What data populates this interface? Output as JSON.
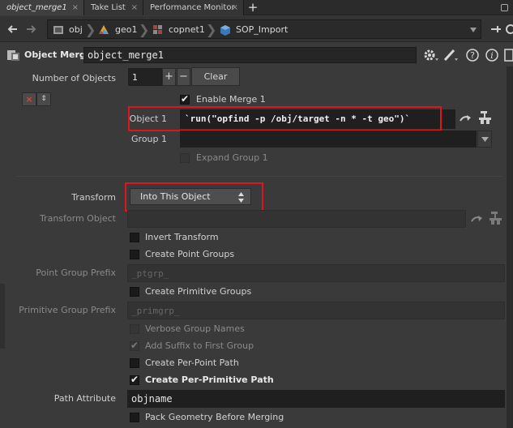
{
  "tabs": [
    {
      "label": "object_merge1",
      "close": "×"
    },
    {
      "label": "Take List",
      "close": "×"
    },
    {
      "label": "Performance Monitor",
      "close": "×"
    }
  ],
  "add_tab": "+",
  "path": [
    "obj",
    "geo1",
    "copnet1",
    "SOP_Import"
  ],
  "header": {
    "node_type": "Object Merge",
    "node_name": "object_merge1"
  },
  "params": {
    "num_objects_label": "Number of Objects",
    "num_objects_value": "1",
    "plus": "+",
    "minus": "−",
    "clear": "Clear",
    "enable_merge": "Enable Merge 1",
    "object1_label": "Object 1",
    "object1_value": "`run(\"opfind -p /obj/target -n * -t geo\")`",
    "group1_label": "Group 1",
    "expand_group": "Expand Group 1",
    "transform_label": "Transform",
    "transform_value": "Into This Object",
    "transform_object_label": "Transform Object",
    "invert_transform": "Invert Transform",
    "create_point_groups": "Create Point Groups",
    "point_group_prefix_label": "Point Group Prefix",
    "point_group_prefix_value": "_ptgrp_",
    "create_primitive_groups": "Create Primitive Groups",
    "primitive_group_prefix_label": "Primitive Group Prefix",
    "primitive_group_prefix_value": "_primgrp_",
    "verbose_group_names": "Verbose Group Names",
    "add_suffix": "Add Suffix to First Group",
    "create_per_point_path": "Create Per-Point Path",
    "create_per_primitive_path": "Create Per-Primitive Path",
    "path_attribute_label": "Path Attribute",
    "path_attribute_value": "objname",
    "pack_geometry": "Pack Geometry Before Merging"
  },
  "colors": {
    "highlight": "#e0141e",
    "background": "#3a3a3a"
  }
}
